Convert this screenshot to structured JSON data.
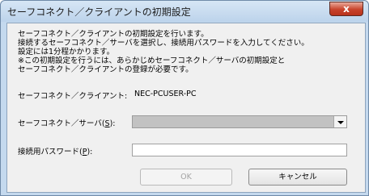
{
  "window": {
    "title": "セーフコネクト／クライアントの初期設定",
    "close_label": "x"
  },
  "message": {
    "lines": [
      "セーフコネクト／クライアントの初期設定を行います。",
      "接続するセーフコネクト／サーバを選択し、接続用パスワードを入力してください。",
      "設定には1分程かかります。",
      "※この初期設定を行うには、あらかじめセーフコネクト／サーバの初期設定と",
      "セーフコネクト／クライアントの登録が必要です。"
    ]
  },
  "client": {
    "label": "セーフコネクト／クライアント:",
    "value": "NEC-PCUSER-PC"
  },
  "server": {
    "label_pre": "セーフコネクト／サーバ(",
    "label_key": "S",
    "label_post": "):",
    "selected_value": ""
  },
  "password": {
    "label_pre": "接続用パスワード(",
    "label_key": "P",
    "label_post": "):",
    "value": ""
  },
  "buttons": {
    "ok": "OK",
    "cancel": "キャンセル"
  }
}
